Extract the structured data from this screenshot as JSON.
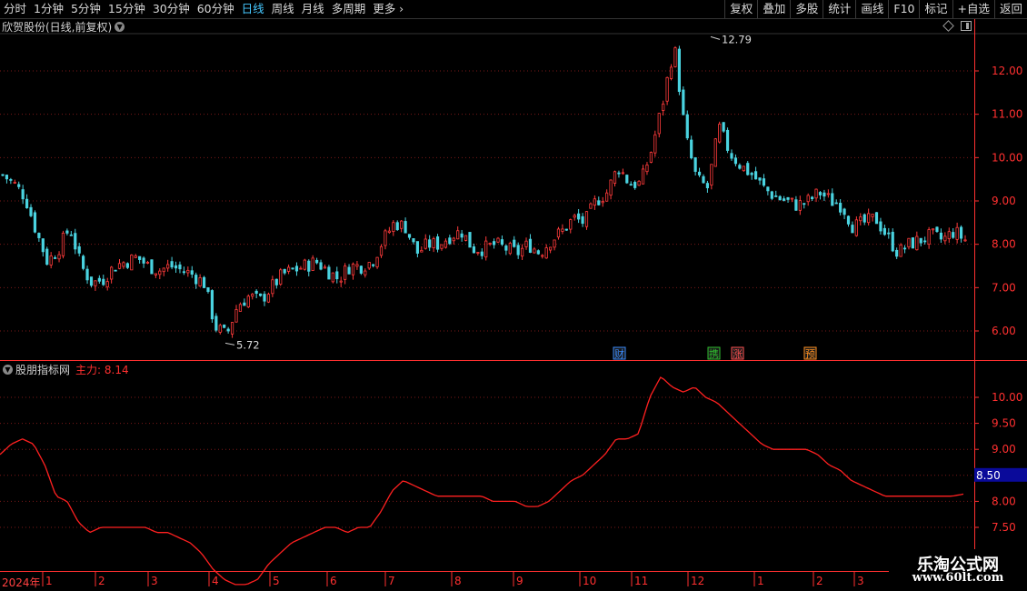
{
  "toolbar": {
    "periods": [
      "分时",
      "1分钟",
      "5分钟",
      "15分钟",
      "30分钟",
      "60分钟",
      "日线",
      "周线",
      "月线",
      "多周期",
      "更多"
    ],
    "active_period": "日线",
    "tools": [
      "复权",
      "叠加",
      "多股",
      "统计",
      "画线",
      "F10",
      "标记",
      "+自选",
      "返回"
    ]
  },
  "main_chart": {
    "stock_label": "欣贺股份(日线,前复权)",
    "high_label": "12.79",
    "low_label": "5.72",
    "price_ticks": [
      "12.00",
      "11.00",
      "10.00",
      "9.00",
      "8.00",
      "7.00",
      "6.00"
    ],
    "event_markers": [
      {
        "label": "财",
        "color": "#3a8cff"
      },
      {
        "label": "携",
        "color": "#30c030"
      },
      {
        "label": "涨",
        "color": "#ff5050"
      },
      {
        "label": "预",
        "color": "#ff9020"
      }
    ]
  },
  "indicator": {
    "name": "股朋指标网",
    "value_label": "主力: 8.14",
    "ticks": [
      "10.00",
      "9.50",
      "9.00",
      "8.50",
      "8.00",
      "7.50"
    ],
    "current_value": "8.50"
  },
  "x_axis": {
    "year_label": "2024年",
    "months": [
      "1",
      "2",
      "3",
      "4",
      "5",
      "6",
      "7",
      "8",
      "9",
      "10",
      "11",
      "12",
      "1",
      "2",
      "3"
    ]
  },
  "watermark": {
    "title": "乐淘公式网",
    "url": "www.60lt.com"
  },
  "colors": {
    "up": "#ff3b3b",
    "down": "#4ad3e0",
    "grid": "#7a1818",
    "axis": "#ff3030",
    "active_period": "#46c8ff"
  },
  "chart_data": {
    "type": "candlestick",
    "price_range": [
      5.5,
      13.2
    ],
    "close_path": [
      9.6,
      9.4,
      9.1,
      8.3,
      7.6,
      7.9,
      8.4,
      7.5,
      7.1,
      7.2,
      7.5,
      7.6,
      7.7,
      7.5,
      7.4,
      7.5,
      7.4,
      7.3,
      7.1,
      6.1,
      5.9,
      6.6,
      6.8,
      6.7,
      7.0,
      7.3,
      7.4,
      7.5,
      7.6,
      7.4,
      7.2,
      7.5,
      7.5,
      7.6,
      8.1,
      8.5,
      8.4,
      7.8,
      8.0,
      8.0,
      8.2,
      8.3,
      7.9,
      7.9,
      8.0,
      7.9,
      7.8,
      8.0,
      7.8,
      8.1,
      8.3,
      8.6,
      8.5,
      9.0,
      9.2,
      9.8,
      9.4,
      9.4,
      10.2,
      11.3,
      12.6,
      10.5,
      9.5,
      9.3,
      10.7,
      10.1,
      9.8,
      9.6,
      9.3,
      9.1,
      9.0,
      8.9,
      9.0,
      9.2,
      9.0,
      8.9,
      8.4,
      8.5,
      8.6,
      8.2,
      7.8,
      8.0,
      8.1,
      8.2,
      8.1,
      8.3,
      8.1
    ],
    "indicator_range": [
      7.3,
      10.4
    ],
    "indicator_path": [
      8.9,
      9.1,
      9.2,
      9.1,
      8.7,
      8.1,
      8.0,
      7.6,
      7.4,
      7.5,
      7.5,
      7.5,
      7.5,
      7.5,
      7.4,
      7.4,
      7.3,
      7.2,
      7.0,
      6.7,
      6.5,
      6.4,
      6.4,
      6.5,
      6.8,
      7.0,
      7.2,
      7.3,
      7.4,
      7.5,
      7.5,
      7.4,
      7.5,
      7.5,
      7.8,
      8.2,
      8.4,
      8.3,
      8.2,
      8.1,
      8.1,
      8.1,
      8.1,
      8.1,
      8.0,
      8.0,
      8.0,
      7.9,
      7.9,
      8.0,
      8.2,
      8.4,
      8.5,
      8.7,
      8.9,
      9.2,
      9.2,
      9.3,
      10.0,
      10.4,
      10.2,
      10.1,
      10.2,
      10.0,
      9.9,
      9.7,
      9.5,
      9.3,
      9.1,
      9.0,
      9.0,
      9.0,
      9.0,
      8.9,
      8.7,
      8.6,
      8.4,
      8.3,
      8.2,
      8.1,
      8.1,
      8.1,
      8.1,
      8.1,
      8.1,
      8.1,
      8.14
    ]
  }
}
